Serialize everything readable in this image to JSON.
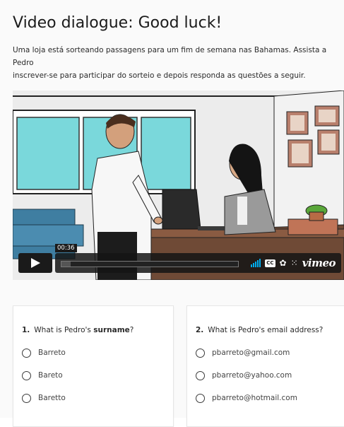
{
  "page": {
    "title": "Video dialogue: Good luck!",
    "intro": "Uma loja está sorteando passagens para um fim de semana nas Bahamas. Assista a Pedro\ninscrever-se para participar do sorteio e depois responda as questões a seguir."
  },
  "video": {
    "timestamp": "00:36",
    "progress_fraction": 0.05,
    "cc_label": "CC",
    "brand": "vimeo",
    "icons": [
      "play-icon",
      "volume-icon",
      "cc-icon",
      "settings-icon",
      "fullscreen-icon"
    ]
  },
  "questions": [
    {
      "number": "1.",
      "text_before": "What is Pedro's ",
      "text_bold": "surname",
      "text_after": "?",
      "options": [
        "Barreto",
        "Bareto",
        "Baretto"
      ]
    },
    {
      "number": "2.",
      "text_before": "What is Pedro's email address?",
      "text_bold": "",
      "text_after": "",
      "options": [
        "pbarreto@gmail.com",
        "pbarreto@yahoo.com",
        "pbarreto@hotmail.com"
      ]
    }
  ],
  "colors": {
    "accent_volume": "#00adef",
    "control_bg": "#1a1a1a"
  }
}
